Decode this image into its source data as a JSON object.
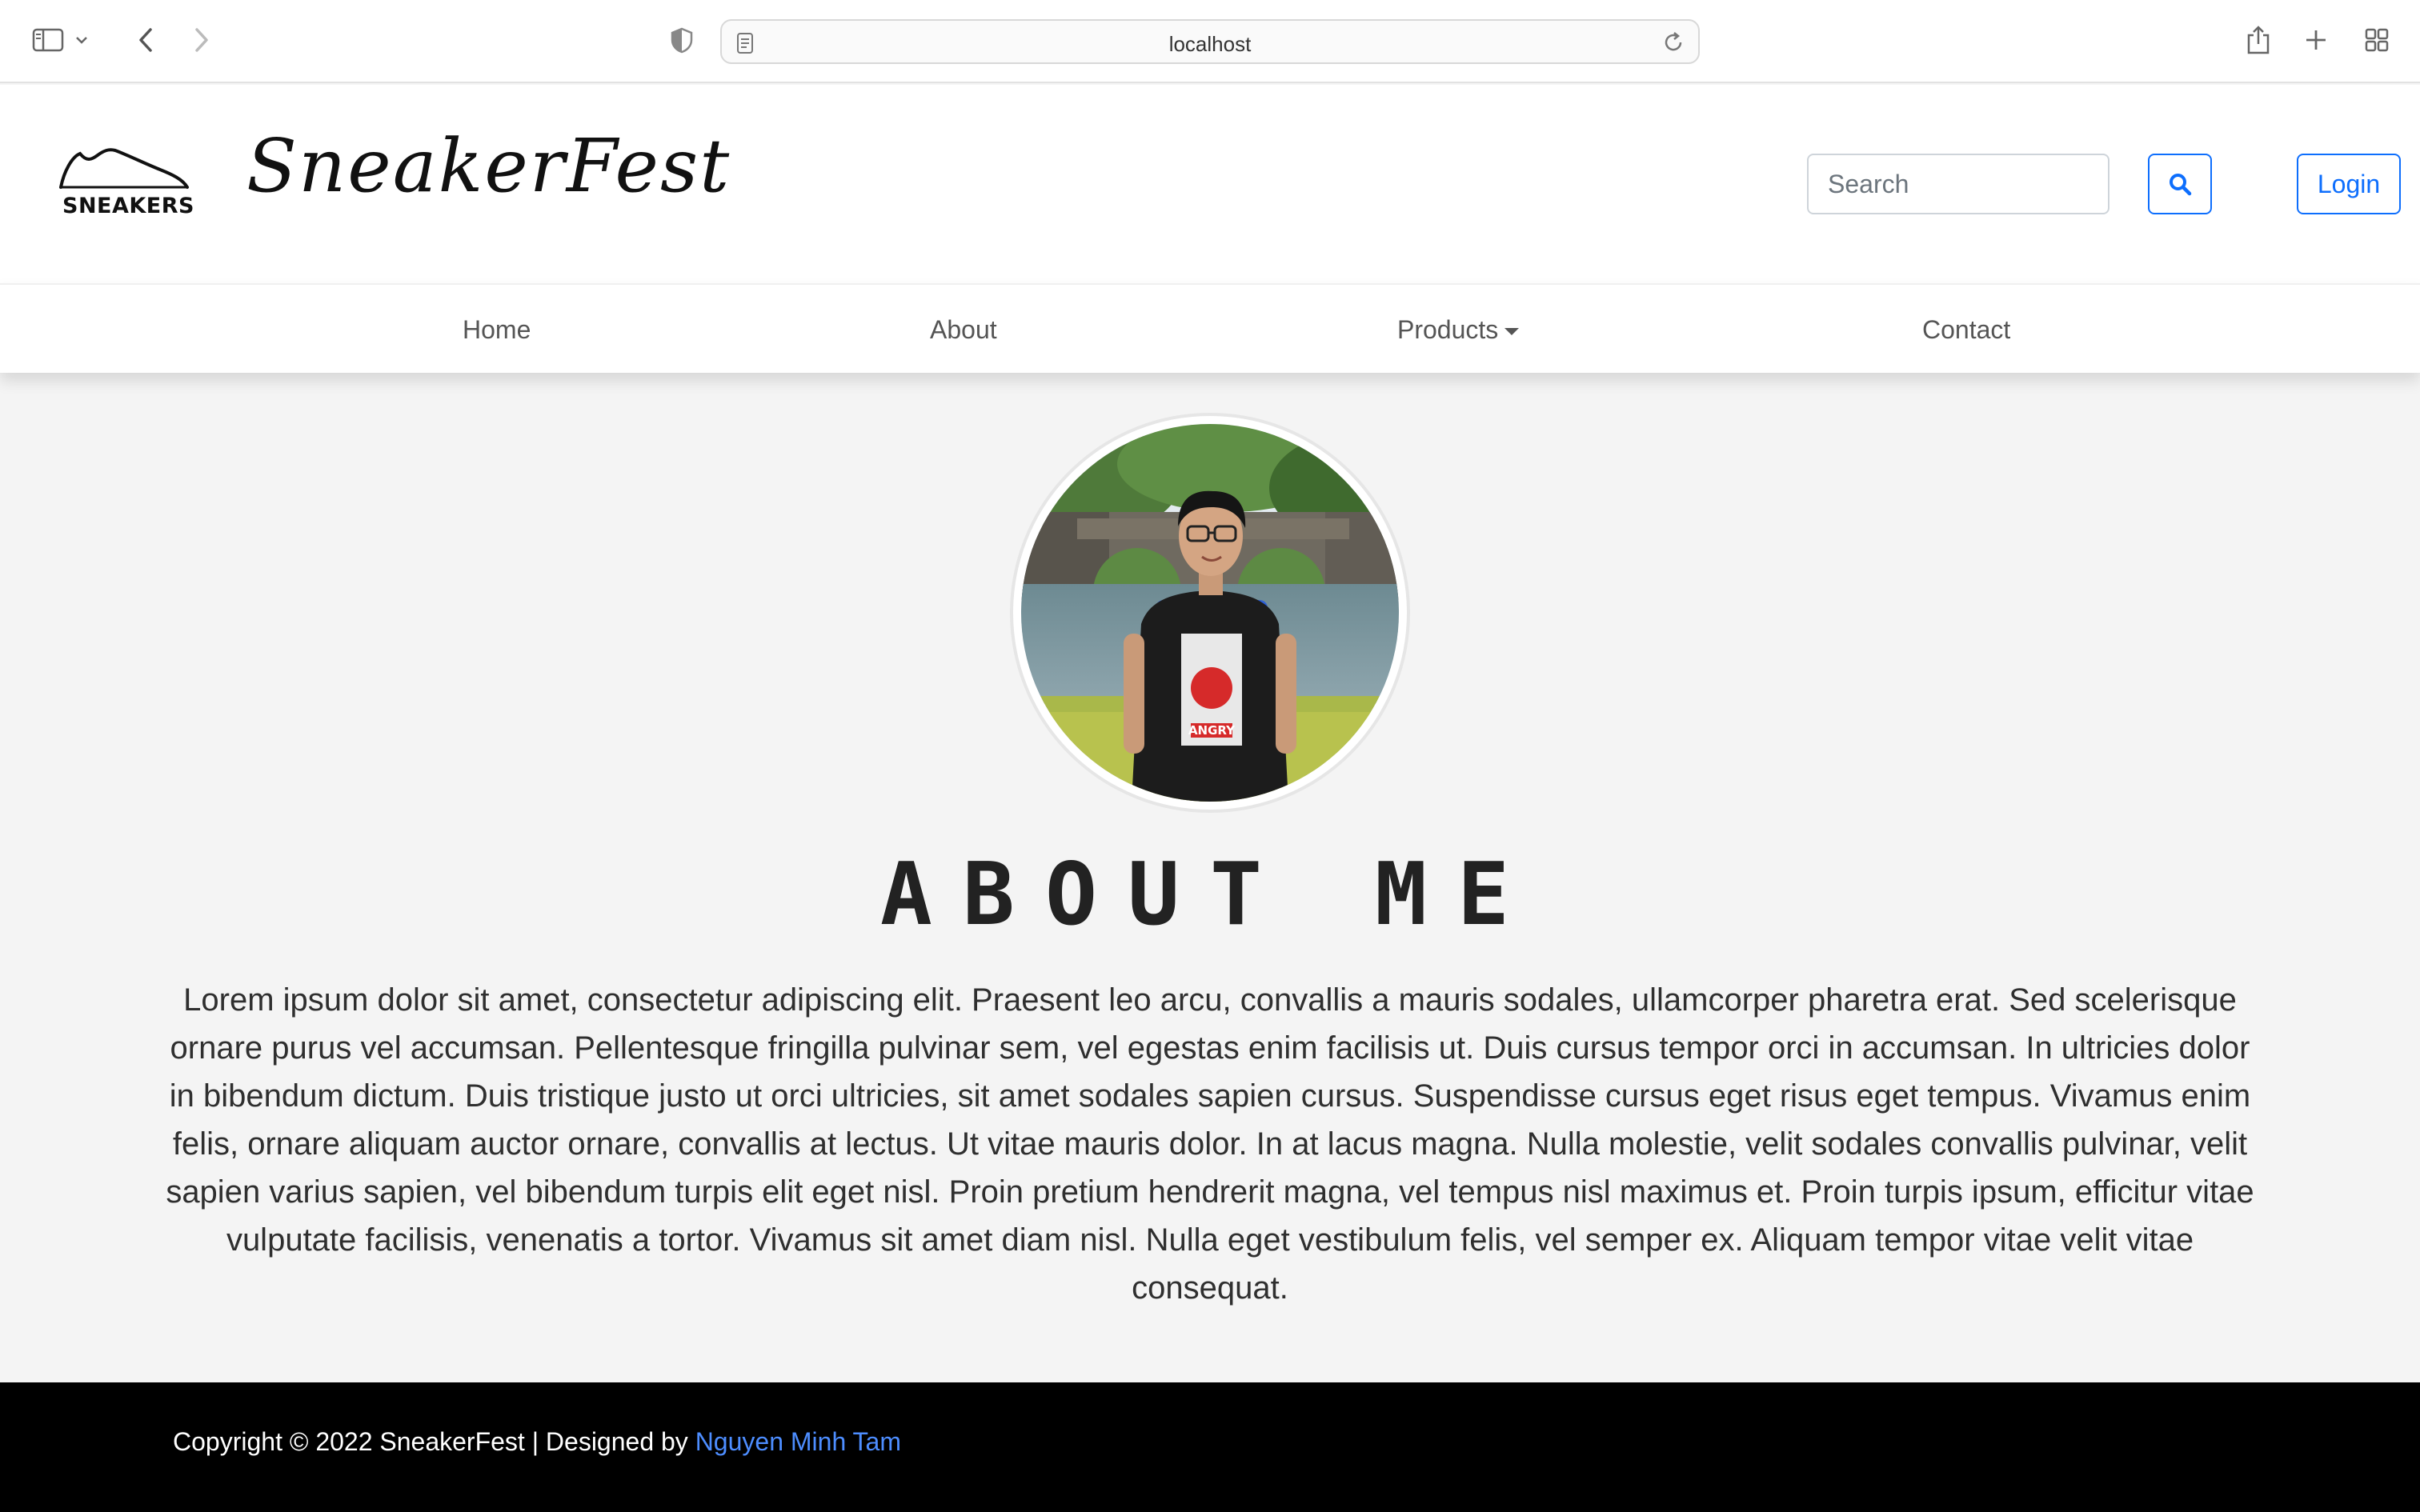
{
  "browser": {
    "url": "localhost"
  },
  "header": {
    "logo_text": "SNEAKERS",
    "brand_name": "SneakerFest",
    "search_placeholder": "Search",
    "login_label": "Login"
  },
  "nav": {
    "items": [
      {
        "label": "Home"
      },
      {
        "label": "About"
      },
      {
        "label": "Products"
      },
      {
        "label": "Contact"
      }
    ]
  },
  "main": {
    "title": "ABOUT ME",
    "body": "Lorem ipsum dolor sit amet, consectetur adipiscing elit. Praesent leo arcu, convallis a mauris sodales, ullamcorper pharetra erat. Sed scelerisque ornare purus vel accumsan. Pellentesque fringilla pulvinar sem, vel egestas enim facilisis ut. Duis cursus tempor orci in accumsan. In ultricies dolor in bibendum dictum. Duis tristique justo ut orci ultricies, sit amet sodales sapien cursus. Suspendisse cursus eget risus eget tempus. Vivamus enim felis, ornare aliquam auctor ornare, convallis at lectus. Ut vitae mauris dolor. In at lacus magna. Nulla molestie, velit sodales convallis pulvinar, velit sapien varius sapien, vel bibendum turpis elit eget nisl. Proin pretium hendrerit magna, vel tempus nisl maximus et. Proin turpis ipsum, efficitur vitae vulputate facilisis, venenatis a tortor. Vivamus sit amet diam nisl. Nulla eget vestibulum felis, vel semper ex. Aliquam tempor vitae velit vitae consequat.",
    "shirt_text": "ANGRY"
  },
  "footer": {
    "copyright": "Copyright © 2022 SneakerFest | Designed by ",
    "designer": "Nguyen Minh Tam"
  },
  "colors": {
    "accent": "#0d6efd",
    "footer_bg": "#000000",
    "link": "#4d8dff"
  },
  "icons": [
    "sidebar-icon",
    "chevron-down-icon",
    "back-icon",
    "forward-icon",
    "shield-icon",
    "page-icon",
    "reload-icon",
    "share-icon",
    "plus-icon",
    "tabs-grid-icon",
    "search-icon"
  ]
}
